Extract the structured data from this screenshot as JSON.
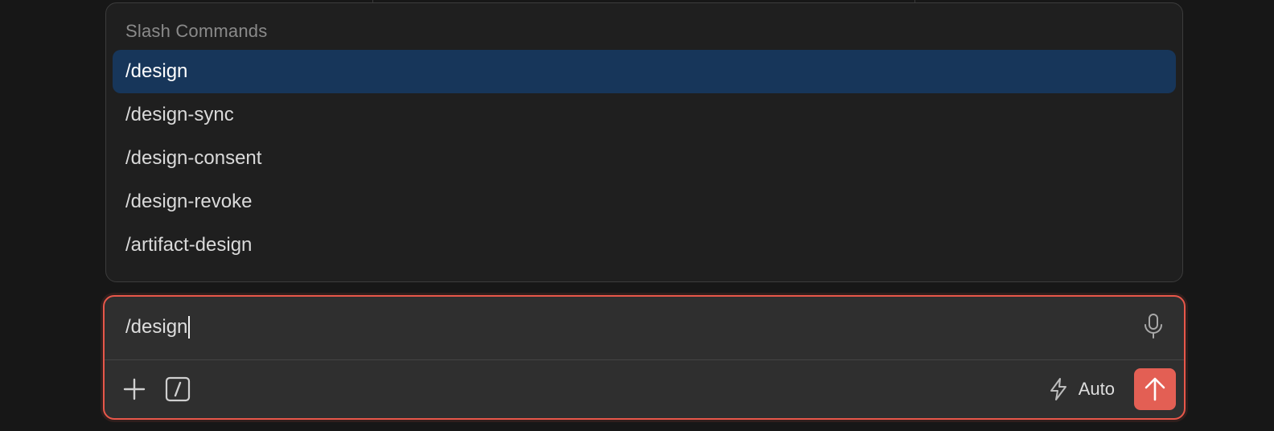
{
  "popup": {
    "header": "Slash Commands",
    "commands": [
      {
        "label": "/design",
        "selected": true
      },
      {
        "label": "/design-sync",
        "selected": false
      },
      {
        "label": "/design-consent",
        "selected": false
      },
      {
        "label": "/design-revoke",
        "selected": false
      },
      {
        "label": "/artifact-design",
        "selected": false
      }
    ]
  },
  "composer": {
    "input_value": "/design",
    "mode_label": "Auto",
    "icons": {
      "mic": "microphone-icon",
      "add": "plus-icon",
      "slash": "slash-command-icon",
      "mode": "lightning-icon",
      "send": "arrow-up-icon"
    }
  },
  "colors": {
    "accent": "#e35f54",
    "selected_row": "#17365a",
    "background": "#171717"
  }
}
